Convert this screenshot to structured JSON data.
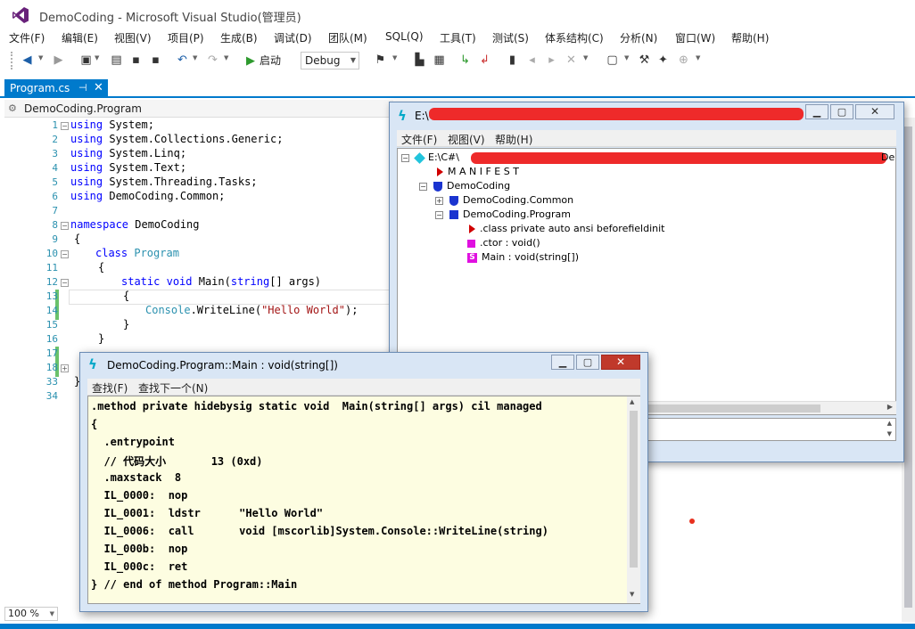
{
  "vs": {
    "title": "DemoCoding - Microsoft Visual Studio(管理员)",
    "menu": [
      "文件(F)",
      "编辑(E)",
      "视图(V)",
      "项目(P)",
      "生成(B)",
      "调试(D)",
      "团队(M)",
      "SQL(Q)",
      "工具(T)",
      "测试(S)",
      "体系结构(C)",
      "分析(N)",
      "窗口(W)",
      "帮助(H)"
    ],
    "toolbar": {
      "start_label": "启动",
      "config_value": "Debug"
    },
    "tab": {
      "label": "Program.cs",
      "pin_icon": "pin-icon",
      "close_icon": "close-icon"
    },
    "nav_label": "DemoCoding.Program",
    "zoom": "100 %",
    "accent_color": "#007acc"
  },
  "editor": {
    "line_numbers": [
      "1",
      "2",
      "3",
      "4",
      "5",
      "6",
      "7",
      "8",
      "9",
      "10",
      "11",
      "12",
      "13",
      "14",
      "15",
      "16",
      "17",
      "18",
      "33",
      "34"
    ],
    "lines": [
      {
        "using": "using",
        "rest": " System;"
      },
      {
        "using": "using",
        "rest": " System.Collections.Generic;"
      },
      {
        "using": "using",
        "rest": " System.Linq;"
      },
      {
        "using": "using",
        "rest": " System.Text;"
      },
      {
        "using": "using",
        "rest": " System.Threading.Tasks;"
      },
      {
        "using": "using",
        "rest": " DemoCoding.Common;"
      }
    ],
    "ns_kw": "namespace",
    "ns_name": " DemoCoding",
    "brace_open": "{",
    "brace_close": "}",
    "class_kw": "class",
    "class_name": "Program",
    "static_kw": "static",
    "void_kw": "void",
    "main_sig": " Main(",
    "string_kw": "string",
    "args": "[] args)",
    "console": "Console",
    "writeline": ".WriteLine(",
    "hello": "\"Hello World\"",
    "tail": ");"
  },
  "ildasm": {
    "title_prefix": "E:\\C",
    "menu": [
      "文件(F)",
      "视图(V)",
      "帮助(H)"
    ],
    "tree": {
      "root": "E:\\C#\\",
      "root_suffix": "De",
      "manifest": "M A N I F E S T",
      "ns": "DemoCoding",
      "common": "DemoCoding.Common",
      "program": "DemoCoding.Program",
      "class_info": ".class private auto ansi beforefieldinit",
      "ctor": ".ctor : void()",
      "main": "Main : void(string[])"
    }
  },
  "il_window": {
    "title": "DemoCoding.Program::Main : void(string[])",
    "menu": [
      "查找(F)",
      "查找下一个(N)"
    ],
    "lines": [
      ".method private hidebysig static void  Main(string[] args) cil managed",
      "{",
      "  .entrypoint",
      "  // 代码大小       13 (0xd)",
      "  .maxstack  8",
      "  IL_0000:  nop",
      "  IL_0001:  ldstr      \"Hello World\"",
      "  IL_0006:  call       void [mscorlib]System.Console::WriteLine(string)",
      "  IL_000b:  nop",
      "  IL_000c:  ret",
      "} // end of method Program::Main"
    ]
  }
}
